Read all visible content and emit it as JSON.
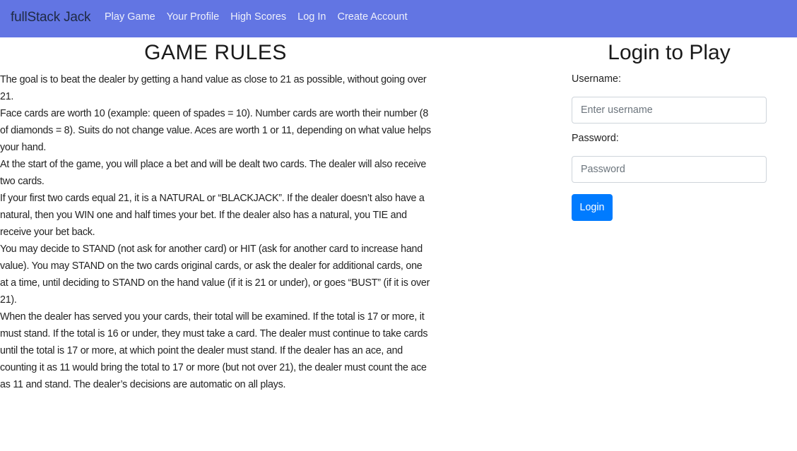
{
  "navbar": {
    "brand": "fullStack Jack",
    "links": [
      "Play Game",
      "Your Profile",
      "High Scores",
      "Log In",
      "Create Account"
    ]
  },
  "rules": {
    "title": "GAME RULES",
    "paragraphs": [
      "The goal is to beat the dealer by getting a hand value as close to 21 as possible, without going over 21.",
      "Face cards are worth 10 (example: queen of spades = 10). Number cards are worth their number (8 of diamonds = 8). Suits do not change value. Aces are worth 1 or 11, depending on what value helps your hand.",
      "At the start of the game, you will place a bet and will be dealt two cards. The dealer will also receive two cards.",
      "If your first two cards equal 21, it is a NATURAL or “BLACKJACK”. If the dealer doesn’t also have a natural, then you WIN one and half times your bet. If the dealer also has a natural, you TIE and receive your bet back.",
      "You may decide to STAND (not ask for another card) or HIT (ask for another card to increase hand value). You may STAND on the two cards original cards, or ask the dealer for additional cards, one at a time, until deciding to STAND on the hand value (if it is 21 or under), or goes “BUST” (if it is over 21).",
      "When the dealer has served you your cards, their total will be examined. If the total is 17 or more, it must stand. If the total is 16 or under, they must take a card. The dealer must continue to take cards until the total is 17 or more, at which point the dealer must stand. If the dealer has an ace, and counting it as 11 would bring the total to 17 or more (but not over 21), the dealer must count the ace as 11 and stand. The dealer’s decisions are automatic on all plays."
    ]
  },
  "login": {
    "title": "Login to Play",
    "username_label": "Username:",
    "username_placeholder": "Enter username",
    "username_value": "",
    "password_label": "Password:",
    "password_placeholder": "Password",
    "password_value": "",
    "button_label": "Login"
  },
  "colors": {
    "navbar_bg": "#6275e3",
    "button_bg": "#007bff"
  }
}
